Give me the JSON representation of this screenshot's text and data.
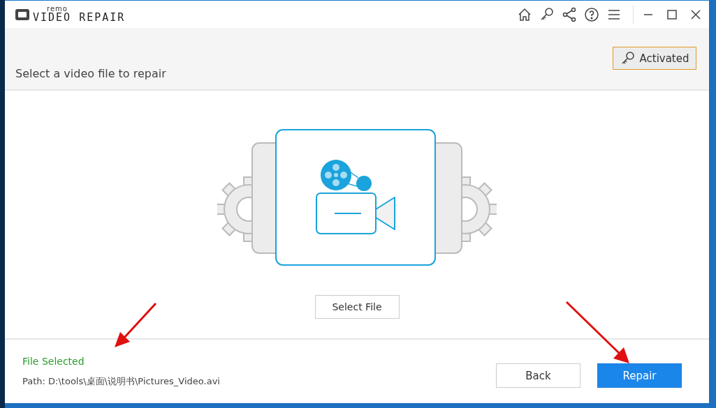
{
  "window": {
    "logo_small": "remo",
    "logo_title": "VIDEO REPAIR"
  },
  "header": {
    "instruction": "Select a video file to repair",
    "activation_button": "Activated"
  },
  "main": {
    "select_button": "Select File"
  },
  "footer": {
    "status": "File Selected",
    "path": "Path: D:\\tools\\桌面\\说明书\\Pictures_Video.avi",
    "back_button": "Back",
    "repair_button": "Repair"
  }
}
